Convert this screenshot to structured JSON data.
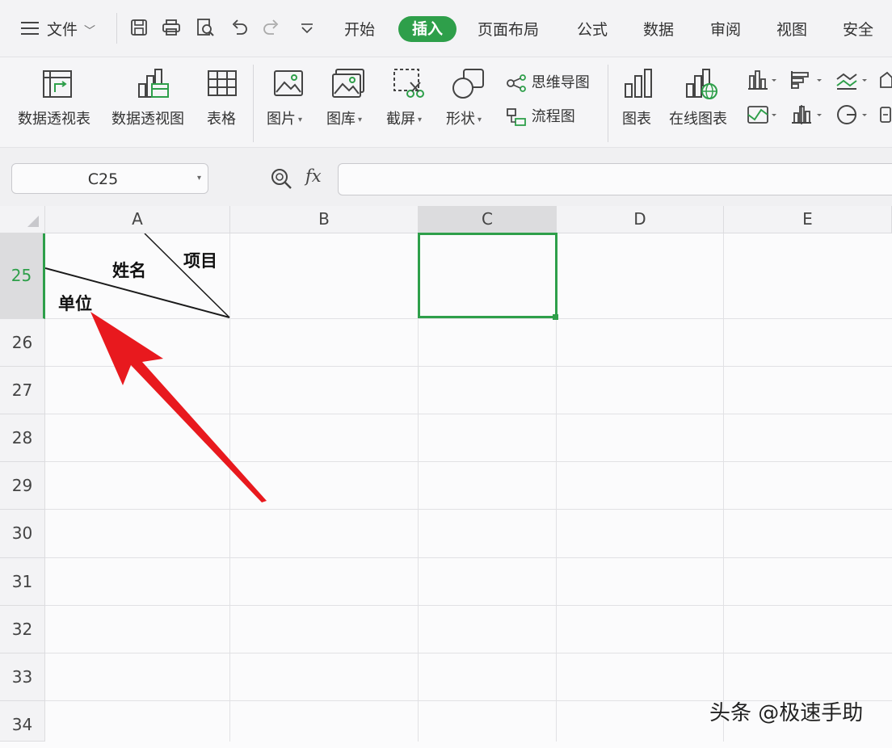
{
  "menubar": {
    "file": "文件",
    "tabs": [
      "开始",
      "插入",
      "页面布局",
      "公式",
      "数据",
      "审阅",
      "视图",
      "安全"
    ],
    "active_tab": "插入"
  },
  "ribbon": {
    "pivot_table": "数据透视表",
    "pivot_chart": "数据透视图",
    "table": "表格",
    "picture": "图片",
    "gallery": "图库",
    "screenshot": "截屏",
    "shape": "形状",
    "mindmap": "思维导图",
    "flowchart": "流程图",
    "chart": "图表",
    "online_chart": "在线图表"
  },
  "formula_bar": {
    "name_box": "C25",
    "fx": "fx",
    "formula": ""
  },
  "grid": {
    "columns": [
      "A",
      "B",
      "C",
      "D",
      "E"
    ],
    "selected_column": "C",
    "rows": [
      "25",
      "26",
      "27",
      "28",
      "29",
      "30",
      "31",
      "32",
      "33",
      "34"
    ],
    "selected_row": "25",
    "active_cell": "C25",
    "cell_a25": {
      "top_right": "项目",
      "middle": "姓名",
      "bottom_left": "单位"
    }
  },
  "annotation": {
    "arrow_color": "#e8191e"
  },
  "watermark": "头条 @极速手助",
  "colors": {
    "accent": "#2e9f4a"
  }
}
